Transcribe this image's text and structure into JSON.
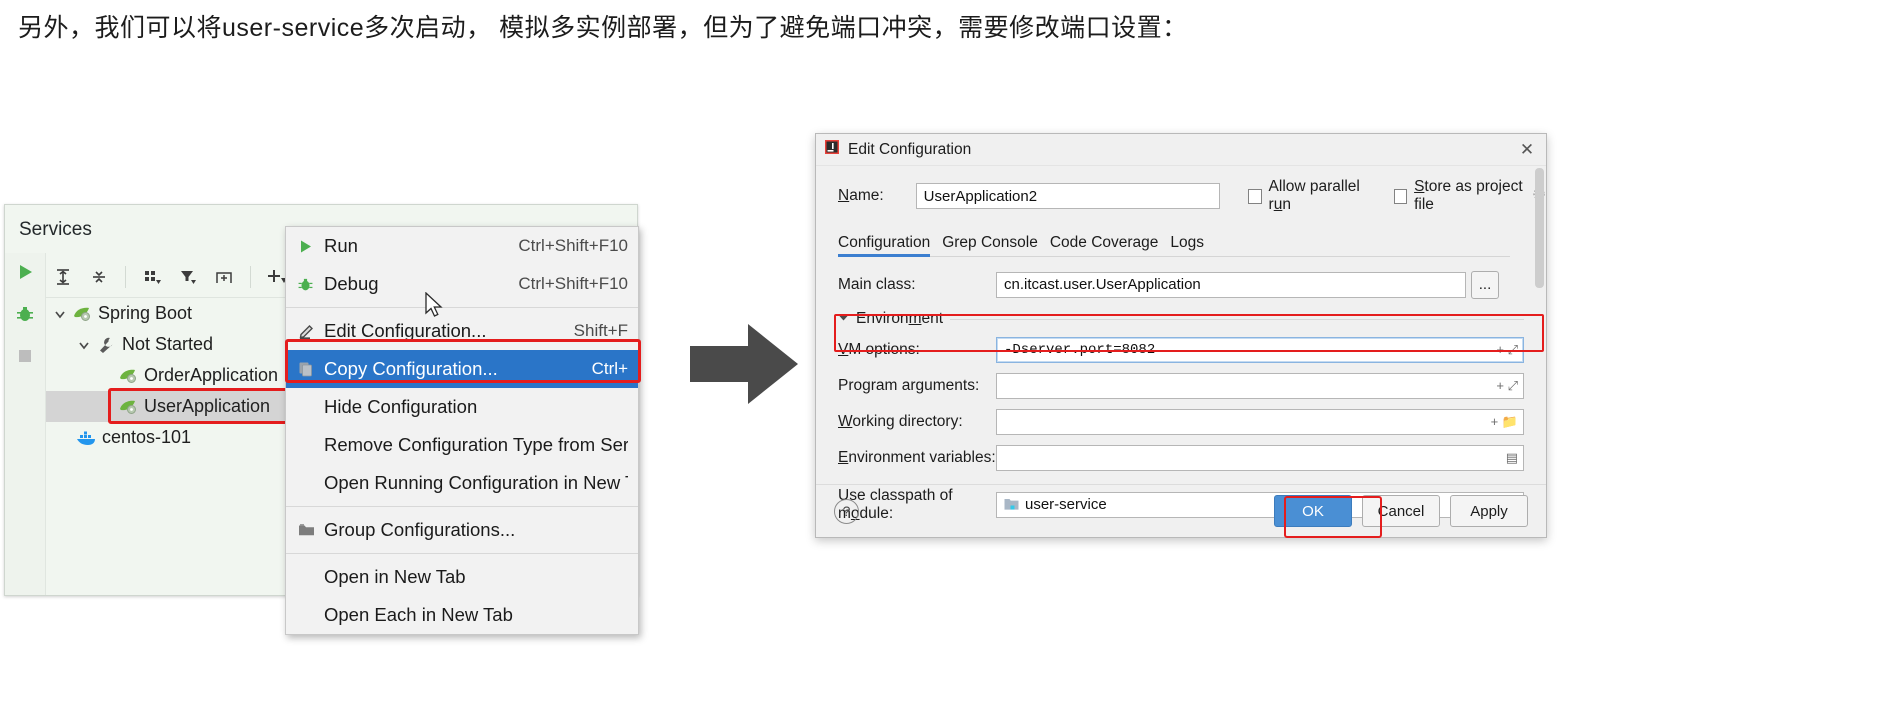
{
  "caption": "另外，我们可以将user-service多次启动， 模拟多实例部署，但为了避免端口冲突，需要修改端口设置：",
  "services": {
    "title": "Services",
    "gutter_icons": [
      "run-icon",
      "debug-icon",
      "stop-icon"
    ],
    "toolbar_icons": [
      "expand-all-icon",
      "collapse-all-icon",
      "group-by-icon",
      "filter-icon",
      "add-tab-icon",
      "add-icon"
    ],
    "tree": [
      {
        "label": "Spring Boot",
        "icon": "spring-boot-icon",
        "depth": 0,
        "expanded": true,
        "selected": false
      },
      {
        "label": "Not Started",
        "icon": "wrench-icon",
        "depth": 1,
        "expanded": true,
        "selected": false
      },
      {
        "label": "OrderApplication",
        "icon": "spring-boot-icon",
        "depth": 2,
        "expanded": null,
        "selected": false
      },
      {
        "label": "UserApplication",
        "icon": "spring-boot-icon",
        "depth": 2,
        "expanded": null,
        "selected": true
      },
      {
        "label": "centos-101",
        "icon": "docker-icon",
        "depth": 1,
        "expanded": null,
        "selected": false
      }
    ]
  },
  "context_menu": {
    "items": [
      {
        "label": "Run",
        "shortcut": "Ctrl+Shift+F10",
        "icon": "run-icon",
        "selected": false,
        "separator_after": false
      },
      {
        "label": "Debug",
        "shortcut": "Ctrl+Shift+F10",
        "icon": "debug-icon",
        "selected": false,
        "separator_after": true
      },
      {
        "label": "Edit Configuration...",
        "shortcut": "Shift+F",
        "icon": "pencil-icon",
        "selected": false,
        "separator_after": false
      },
      {
        "label": "Copy Configuration...",
        "shortcut": "Ctrl+",
        "icon": "copy-icon",
        "selected": true,
        "separator_after": false
      },
      {
        "label": "Hide Configuration",
        "shortcut": "",
        "icon": "",
        "selected": false,
        "separator_after": false
      },
      {
        "label": "Remove Configuration Type from Services",
        "shortcut": "",
        "icon": "",
        "selected": false,
        "separator_after": false
      },
      {
        "label": "Open Running Configuration in New Tab",
        "shortcut": "",
        "icon": "",
        "selected": false,
        "separator_after": true
      },
      {
        "label": "Group Configurations...",
        "shortcut": "",
        "icon": "folder-icon",
        "selected": false,
        "separator_after": true
      },
      {
        "label": "Open in New Tab",
        "shortcut": "",
        "icon": "",
        "selected": false,
        "separator_after": false
      },
      {
        "label": "Open Each in New Tab",
        "shortcut": "",
        "icon": "",
        "selected": false,
        "separator_after": false
      }
    ]
  },
  "dialog": {
    "title": "Edit Configuration",
    "close_label": "✕",
    "name_label": "Name:",
    "name_value": "UserApplication2",
    "allow_parallel_run_label": "Allow parallel run",
    "allow_parallel_run_checked": false,
    "store_as_project_file_label": "Store as project file",
    "store_as_project_file_checked": false,
    "tabs": [
      {
        "label": "Configuration",
        "active": true
      },
      {
        "label": "Grep Console",
        "active": false
      },
      {
        "label": "Code Coverage",
        "active": false
      },
      {
        "label": "Logs",
        "active": false
      }
    ],
    "main_class_label": "Main class:",
    "main_class_value": "cn.itcast.user.UserApplication",
    "main_class_browse": "...",
    "environment_label": "Environment",
    "fields": [
      {
        "label": "VM options:",
        "value": "-Dserver.port=8082",
        "highlight": true,
        "adornments": "+ ⤢"
      },
      {
        "label": "Program arguments:",
        "value": "",
        "highlight": false,
        "adornments": "+ ⤢"
      },
      {
        "label": "Working directory:",
        "value": "",
        "highlight": false,
        "adornments": "+ 📁"
      },
      {
        "label": "Environment variables:",
        "value": "",
        "highlight": false,
        "adornments": "▤"
      }
    ],
    "module_label": "Use classpath of module:",
    "module_value": "user-service",
    "help_label": "?",
    "buttons": [
      {
        "label": "OK",
        "primary": true,
        "highlight": true
      },
      {
        "label": "Cancel",
        "primary": false,
        "highlight": false
      },
      {
        "label": "Apply",
        "primary": false,
        "highlight": false
      }
    ]
  },
  "colors": {
    "accent_blue": "#2a75c8",
    "highlight_red": "#e41d1d",
    "spring_green": "#6db33f",
    "primary_button": "#4a8fd4"
  }
}
